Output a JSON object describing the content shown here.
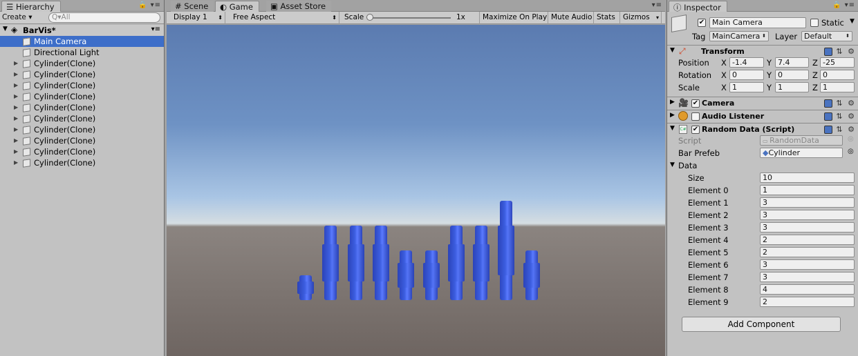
{
  "hierarchy": {
    "tab": "Hierarchy",
    "create": "Create",
    "search_placeholder": "All",
    "scene": "BarVis*",
    "items": [
      "Main Camera",
      "Directional Light",
      "Cylinder(Clone)",
      "Cylinder(Clone)",
      "Cylinder(Clone)",
      "Cylinder(Clone)",
      "Cylinder(Clone)",
      "Cylinder(Clone)",
      "Cylinder(Clone)",
      "Cylinder(Clone)",
      "Cylinder(Clone)",
      "Cylinder(Clone)"
    ]
  },
  "center": {
    "tabs": [
      "Scene",
      "Game",
      "Asset Store"
    ],
    "toolbar": {
      "display": "Display 1",
      "aspect": "Free Aspect",
      "scale_label": "Scale",
      "scale_value": "1x",
      "maximize": "Maximize On Play",
      "mute": "Mute Audio",
      "stats": "Stats",
      "gizmos": "Gizmos"
    },
    "bar_color": "#3c5ee0",
    "bars": [
      1,
      3,
      3,
      3,
      2,
      2,
      3,
      3,
      4,
      2
    ]
  },
  "inspector": {
    "tab": "Inspector",
    "object_name": "Main Camera",
    "static_label": "Static",
    "tag_label": "Tag",
    "tag_value": "MainCamera",
    "layer_label": "Layer",
    "layer_value": "Default",
    "transform": {
      "title": "Transform",
      "position_label": "Position",
      "rotation_label": "Rotation",
      "scale_label": "Scale",
      "position": {
        "x": "-1.4",
        "y": "7.4",
        "z": "-25"
      },
      "rotation": {
        "x": "0",
        "y": "0",
        "z": "0"
      },
      "scale": {
        "x": "1",
        "y": "1",
        "z": "1"
      }
    },
    "camera_title": "Camera",
    "audio_title": "Audio Listener",
    "script": {
      "title": "Random Data (Script)",
      "script_label": "Script",
      "script_value": "RandomData",
      "prefab_label": "Bar Prefeb",
      "prefab_value": "Cylinder",
      "data_label": "Data",
      "size_label": "Size",
      "size_value": "10",
      "elements": [
        {
          "label": "Element 0",
          "value": "1"
        },
        {
          "label": "Element 1",
          "value": "3"
        },
        {
          "label": "Element 2",
          "value": "3"
        },
        {
          "label": "Element 3",
          "value": "3"
        },
        {
          "label": "Element 4",
          "value": "2"
        },
        {
          "label": "Element 5",
          "value": "2"
        },
        {
          "label": "Element 6",
          "value": "3"
        },
        {
          "label": "Element 7",
          "value": "3"
        },
        {
          "label": "Element 8",
          "value": "4"
        },
        {
          "label": "Element 9",
          "value": "2"
        }
      ]
    },
    "add_component": "Add Component"
  }
}
